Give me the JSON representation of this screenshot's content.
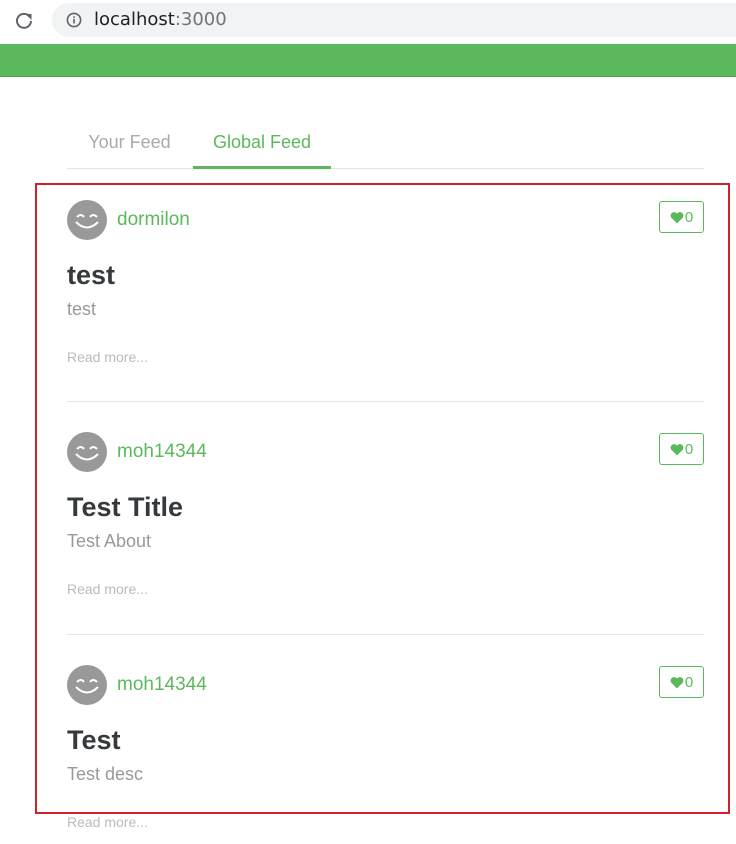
{
  "browser": {
    "url_host": "localhost",
    "url_port": ":3000"
  },
  "tabs": [
    {
      "label": "Your Feed",
      "active": false
    },
    {
      "label": "Global Feed",
      "active": true
    }
  ],
  "articles": [
    {
      "author": "dormilon",
      "favorites": "0",
      "title": "test",
      "description": "test",
      "read_more": "Read more..."
    },
    {
      "author": "moh14344",
      "favorites": "0",
      "title": "Test Title",
      "description": "Test About",
      "read_more": "Read more..."
    },
    {
      "author": "moh14344",
      "favorites": "0",
      "title": "Test",
      "description": "Test desc",
      "read_more": "Read more..."
    }
  ],
  "colors": {
    "brand": "#5cb85c",
    "highlight": "#d0212b",
    "title": "#373a3c",
    "muted": "#999999"
  },
  "icons": {
    "reload": "reload-icon",
    "info": "info-icon",
    "avatar": "smiley-avatar-icon",
    "favorite": "heart-icon"
  }
}
